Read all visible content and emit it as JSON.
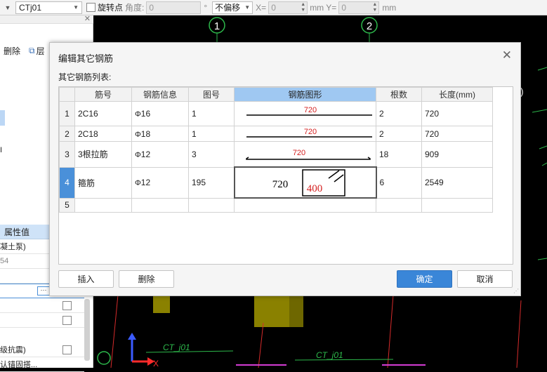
{
  "toolbar": {
    "element_name": "CTj01",
    "rotate_point_label": "旋转点",
    "angle_label": "角度:",
    "angle_value": "0",
    "degree_unit": "°",
    "offset_option": "不偏移",
    "x_label": "X=",
    "x_value": "0",
    "mm_y_label": "mm Y=",
    "y_value": "0",
    "mm_label": "mm"
  },
  "left_panel": {
    "delete_label": "删除",
    "layer_label": "层",
    "marker": "I",
    "property_value_header": "属性值",
    "rows": [
      "凝土泵)",
      "54",
      "",
      "",
      "",
      "级抗震)",
      "认锚固搭..."
    ],
    "dots_label": "···"
  },
  "canvas": {
    "axis_labels": [
      "1",
      "2"
    ],
    "right_bracket": ")",
    "ct_labels": [
      "CT_j01",
      "CT_j01"
    ],
    "axis_x": "X"
  },
  "dialog": {
    "title": "编辑其它钢筋",
    "subtitle": "其它钢筋列表:",
    "columns": [
      "筋号",
      "钢筋信息",
      "图号",
      "钢筋图形",
      "根数",
      "长度(mm)"
    ],
    "rows": [
      {
        "index": "1",
        "name": "2C16",
        "info": "16",
        "shape_no": "1",
        "dim": "720",
        "count": "2",
        "length": "720"
      },
      {
        "index": "2",
        "name": "2C18",
        "info": "18",
        "shape_no": "1",
        "dim": "720",
        "count": "2",
        "length": "720"
      },
      {
        "index": "3",
        "name": "3根拉筋",
        "info": "12",
        "shape_no": "3",
        "dim": "720",
        "count": "18",
        "length": "909"
      },
      {
        "index": "4",
        "name": "箍筋",
        "info": "12",
        "shape_no": "195",
        "dim": "720",
        "dim2": "400",
        "count": "6",
        "length": "2549"
      },
      {
        "index": "5",
        "name": "",
        "info": "",
        "shape_no": "",
        "dim": "",
        "count": "",
        "length": ""
      }
    ],
    "buttons": {
      "insert": "插入",
      "delete": "删除",
      "ok": "确定",
      "cancel": "取消"
    }
  }
}
